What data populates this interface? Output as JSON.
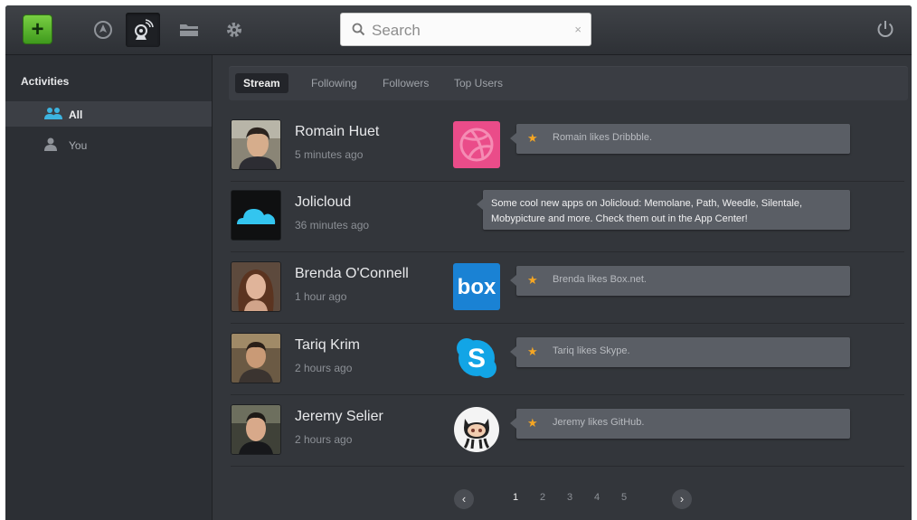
{
  "toolbar": {
    "add_label": "+",
    "search_placeholder": "Search",
    "clear_label": "×",
    "icons": [
      "add-icon",
      "apps-icon",
      "social-icon",
      "folder-icon",
      "settings-icon",
      "power-icon"
    ]
  },
  "sidebar": {
    "title": "Activities",
    "items": [
      {
        "label": "All",
        "icon": "users-icon",
        "selected": true
      },
      {
        "label": "You",
        "icon": "user-icon",
        "selected": false
      }
    ]
  },
  "tabs": [
    {
      "label": "Stream",
      "active": true
    },
    {
      "label": "Following",
      "active": false
    },
    {
      "label": "Followers",
      "active": false
    },
    {
      "label": "Top Users",
      "active": false
    }
  ],
  "stream": [
    {
      "name": "Romain Huet",
      "time": "5 minutes ago",
      "app": "dribbble-icon",
      "text": "Romain likes Dribbble."
    },
    {
      "name": "Jolicloud",
      "time": "36 minutes ago",
      "app": null,
      "text": "Some cool new apps on Jolicloud: Memolane, Path, Weedle, Silentale, Mobypicture and more. Check them out in the App Center!"
    },
    {
      "name": "Brenda O'Connell",
      "time": "1 hour ago",
      "app": "box-icon",
      "app_label": "box",
      "text": "Brenda likes Box.net."
    },
    {
      "name": "Tariq Krim",
      "time": "2 hours ago",
      "app": "skype-icon",
      "app_label": "S",
      "text": "Tariq likes Skype."
    },
    {
      "name": "Jeremy Selier",
      "time": "2 hours ago",
      "app": "github-icon",
      "text": "Jeremy likes GitHub."
    }
  ],
  "pagination": {
    "prev": "‹",
    "next": "›",
    "pages": [
      "1",
      "2",
      "3",
      "4",
      "5"
    ],
    "current": "1"
  },
  "colors": {
    "accent_green": "#5fbf2f",
    "star": "#f5a623",
    "dribbble": "#ea4c89",
    "box": "#1a82d4",
    "skype": "#12a5e6"
  }
}
